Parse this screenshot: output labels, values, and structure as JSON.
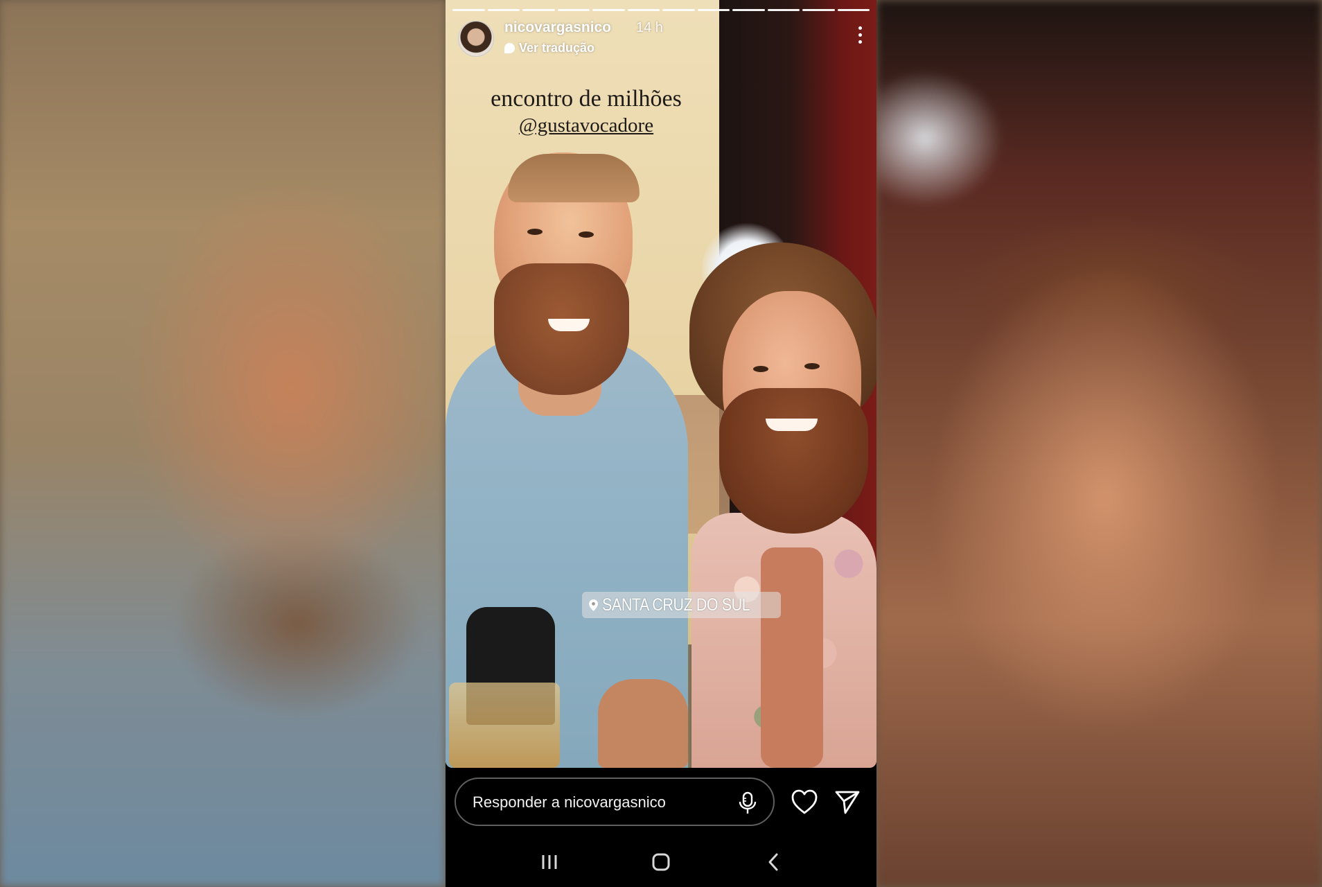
{
  "story": {
    "username": "nicovargasnico",
    "time": "14 h",
    "translate_label": "Ver tradução",
    "caption_line1": "encontro de milhões",
    "caption_line2": "@gustavocadore",
    "location": "SANTA CRUZ DO SUL",
    "progress_segments": 12
  },
  "reply": {
    "placeholder": "Responder a nicovargasnico"
  },
  "icons": {
    "more": "more-vertical-icon",
    "mic": "microphone-icon",
    "heart": "heart-icon",
    "share": "send-icon",
    "location": "location-pin-icon",
    "nav_recents": "recents-icon",
    "nav_home": "home-icon",
    "nav_back": "back-icon"
  },
  "colors": {
    "background": "#000000",
    "text": "#ffffff"
  }
}
